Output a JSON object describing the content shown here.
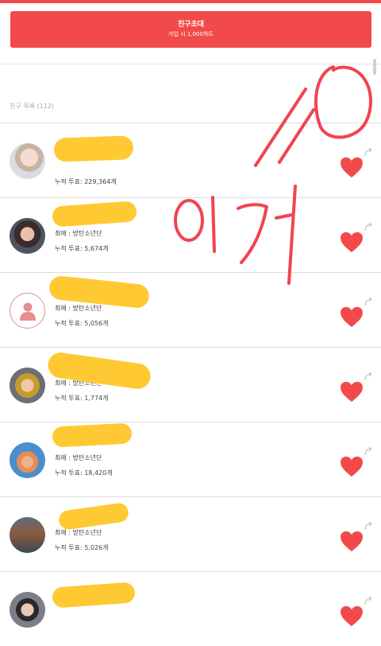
{
  "invite": {
    "title": "친구초대",
    "subtitle": "가입 시 1,000하트"
  },
  "list": {
    "header": "친구 목록 (112)"
  },
  "friends": [
    {
      "fav": "",
      "votes": "누적 투표: 229,364개"
    },
    {
      "fav": "최애 : 방탄소년단",
      "votes": "누적 투표: 5,674개"
    },
    {
      "fav": "최애 : 방탄소년단",
      "votes": "누적 투표: 5,056개"
    },
    {
      "fav": "최애 : 방탄소년단",
      "votes": "누적 투표: 1,774개"
    },
    {
      "fav": "최애 : 방탄소년단",
      "votes": "누적 투표: 18,420개"
    },
    {
      "fav": "최애 : 방탄소년단",
      "votes": "누적 투표: 5,026개"
    },
    {
      "fav": "",
      "votes": ""
    }
  ],
  "icons": {
    "heart": "heart-icon",
    "share": "share-arrow-icon",
    "person": "person-placeholder-icon"
  },
  "colors": {
    "accent": "#f24a4a",
    "highlight_scribble": "#ffc933"
  }
}
